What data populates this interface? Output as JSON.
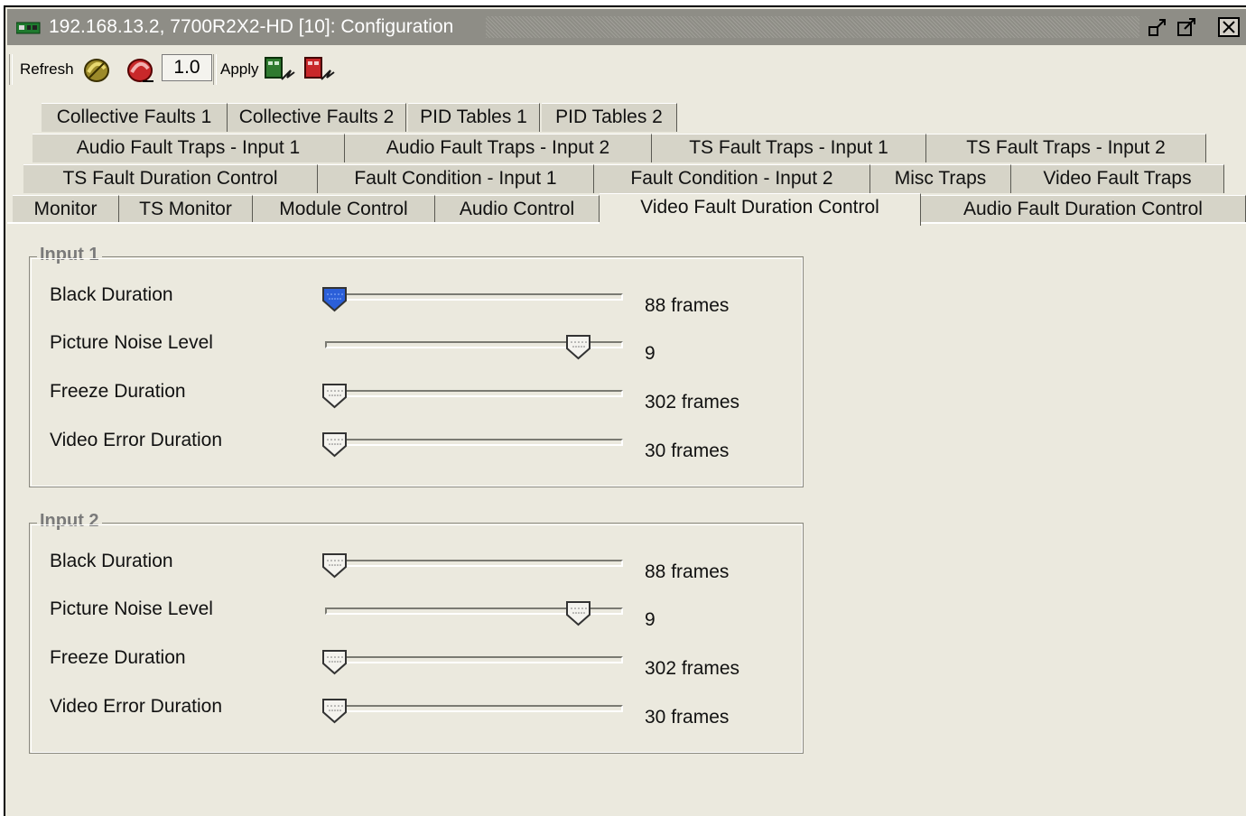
{
  "window": {
    "title": "192.168.13.2, 7700R2X2-HD  [10]: Configuration"
  },
  "toolbar": {
    "refresh_label": "Refresh",
    "zoom_value": "1.0",
    "apply_label": "Apply"
  },
  "tabs": {
    "row1": [
      "Collective Faults 1",
      "Collective Faults 2",
      "PID Tables 1",
      "PID Tables 2"
    ],
    "row2": [
      "Audio Fault Traps - Input 1",
      "Audio Fault Traps - Input 2",
      "TS Fault Traps - Input 1",
      "TS Fault Traps - Input 2"
    ],
    "row3": [
      "TS Fault Duration Control",
      "Fault Condition - Input 1",
      "Fault Condition - Input 2",
      "Misc Traps",
      "Video Fault Traps"
    ],
    "row4": [
      "Monitor",
      "TS Monitor",
      "Module Control",
      "Audio Control",
      "Video Fault Duration Control",
      "Audio Fault Duration Control"
    ],
    "active": "Video Fault Duration Control"
  },
  "groups": [
    {
      "title": "Input 1",
      "rows": [
        {
          "label": "Black Duration",
          "value": "88 frames",
          "level": 0.0,
          "focused": true
        },
        {
          "label": "Picture Noise Level",
          "value": "9",
          "level": 0.9,
          "focused": false
        },
        {
          "label": "Freeze Duration",
          "value": "302 frames",
          "level": 0.0,
          "focused": false
        },
        {
          "label": "Video Error Duration",
          "value": "30 frames",
          "level": 0.0,
          "focused": false
        }
      ]
    },
    {
      "title": "Input 2",
      "rows": [
        {
          "label": "Black Duration",
          "value": "88 frames",
          "level": 0.0,
          "focused": false
        },
        {
          "label": "Picture Noise Level",
          "value": "9",
          "level": 0.9,
          "focused": false
        },
        {
          "label": "Freeze Duration",
          "value": "302 frames",
          "level": 0.0,
          "focused": false
        },
        {
          "label": "Video Error Duration",
          "value": "30 frames",
          "level": 0.0,
          "focused": false
        }
      ]
    }
  ],
  "colors": {
    "background": "#ebe9de",
    "titlebar": "#8e8d86",
    "focused_thumb": "#2b5fd9"
  }
}
